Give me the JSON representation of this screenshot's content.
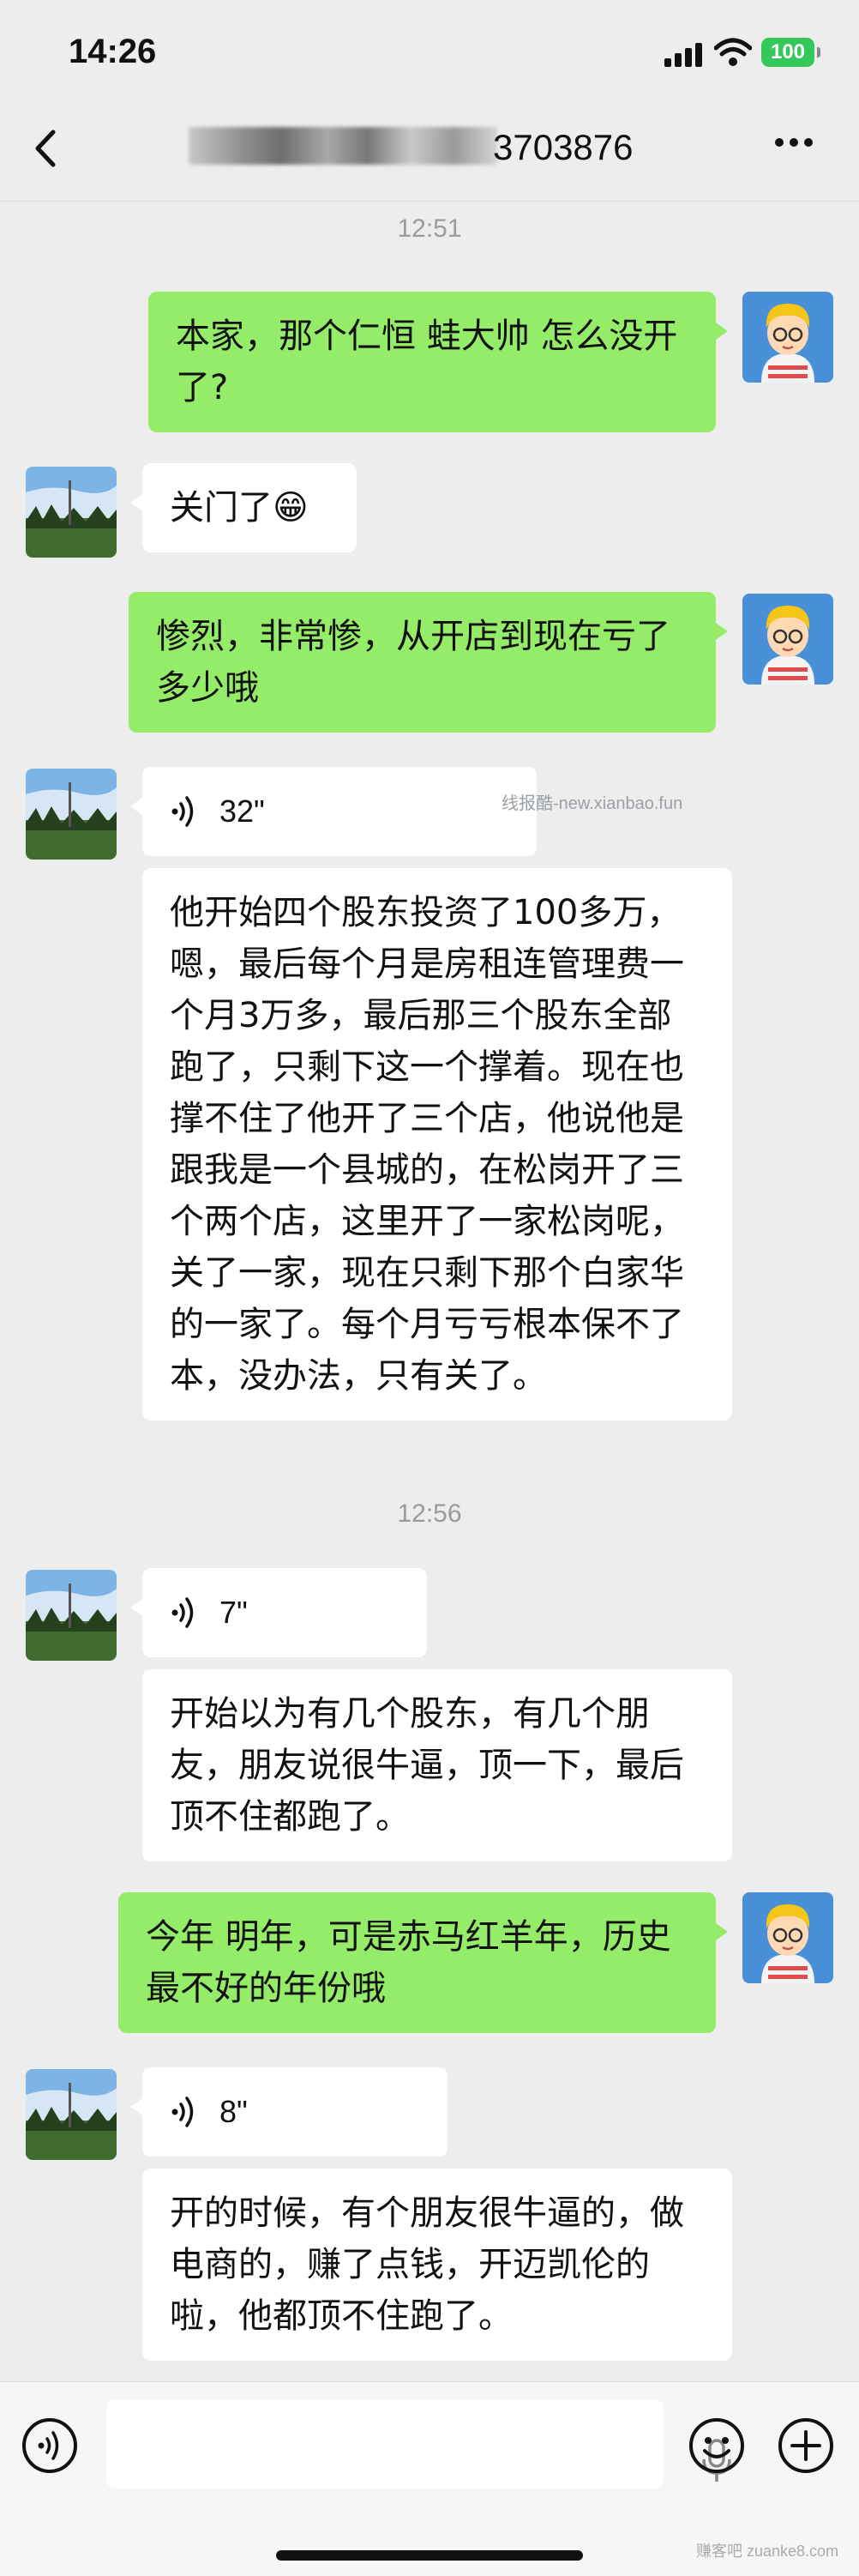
{
  "status_bar": {
    "time": "14:26",
    "battery": "100"
  },
  "header": {
    "title": "3703876"
  },
  "timestamps": [
    "12:51",
    "12:56"
  ],
  "messages": [
    {
      "side": "right",
      "type": "text",
      "text": "本家，那个仁恒 蛙大帅 怎么没开了?"
    },
    {
      "side": "left",
      "type": "text",
      "text": "关门了😁"
    },
    {
      "side": "right",
      "type": "text",
      "text": "惨烈，非常惨，从开店到现在亏了多少哦"
    },
    {
      "side": "left",
      "type": "voice",
      "duration": "32\""
    },
    {
      "side": "left",
      "type": "transcript",
      "text": "他开始四个股东投资了100多万，嗯，最后每个月是房租连管理费一个月3万多，最后那三个股东全部跑了，只剩下这一个撑着。现在也撑不住了他开了三个店，他说他是跟我是一个县城的，在松岗开了三个两个店，这里开了一家松岗呢，关了一家，现在只剩下那个白家华的一家了。每个月亏亏根本保不了本，没办法，只有关了。"
    },
    {
      "side": "left",
      "type": "voice",
      "duration": "7\""
    },
    {
      "side": "left",
      "type": "transcript",
      "text": "开始以为有几个股东，有几个朋友，朋友说很牛逼，顶一下，最后顶不住都跑了。"
    },
    {
      "side": "right",
      "type": "text",
      "text": "今年 明年，可是赤马红羊年，历史最不好的年份哦"
    },
    {
      "side": "left",
      "type": "voice",
      "duration": "8\""
    },
    {
      "side": "left",
      "type": "transcript",
      "text": "开的时候，有个朋友很牛逼的，做电商的，赚了点钱，开迈凯伦的啦，他都顶不住跑了。"
    }
  ],
  "watermark": "线报酷-new.xianbao.fun",
  "watermark_bottom": "赚客吧 zuanke8.com",
  "icons": {
    "back": "chevron-left-icon",
    "more": "more-icon",
    "voice_toggle": "voice-icon",
    "mic": "mic-icon",
    "emoji": "emoji-icon",
    "add": "plus-icon"
  },
  "colors": {
    "sent_bubble": "#95ec69",
    "received_bubble": "#ffffff",
    "background": "#ededed"
  }
}
